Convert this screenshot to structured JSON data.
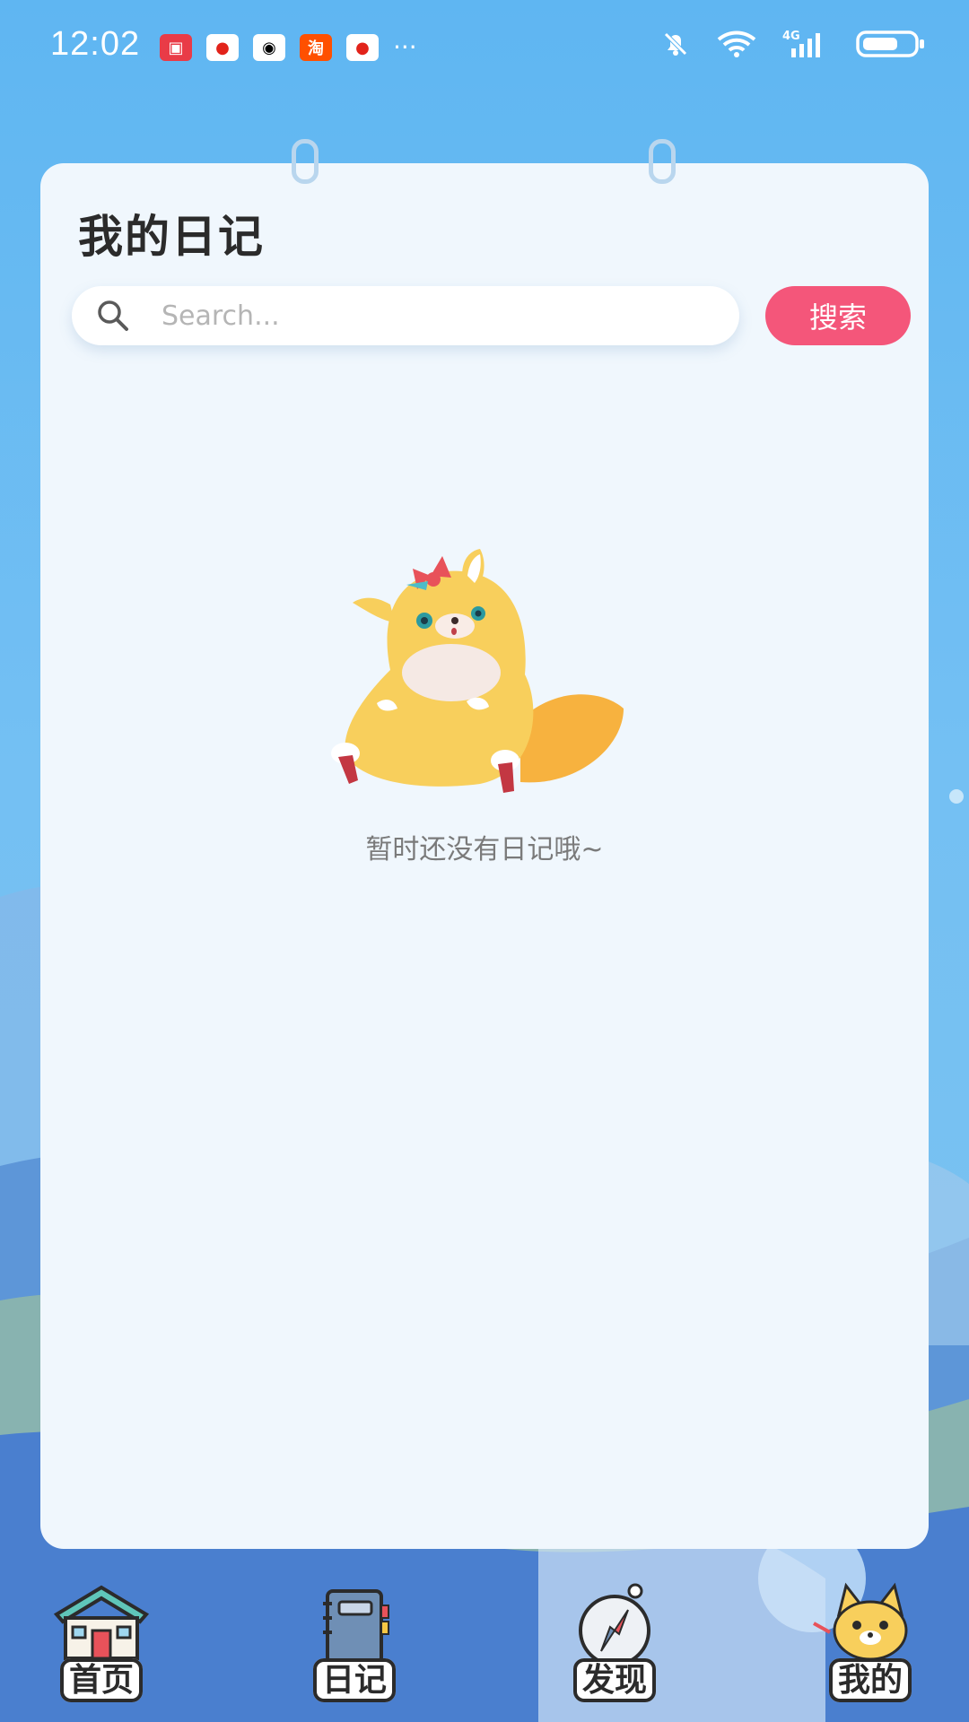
{
  "status_bar": {
    "time": "12:02",
    "notifications": [
      "huawei-icon",
      "jd-icon",
      "qq-icon",
      "taobao-icon",
      "jd-icon"
    ],
    "more": "···",
    "network": "4G"
  },
  "page": {
    "title": "我的日记",
    "search": {
      "placeholder": "Search...",
      "value": ""
    },
    "search_button_label": "搜索",
    "empty_message": "暂时还没有日记哦~"
  },
  "bottom_nav": {
    "items": [
      {
        "label": "首页",
        "icon": "home-icon"
      },
      {
        "label": "日记",
        "icon": "notebook-icon"
      },
      {
        "label": "发现",
        "icon": "compass-icon"
      },
      {
        "label": "我的",
        "icon": "fox-avatar-icon"
      }
    ]
  },
  "colors": {
    "background": "#5fb6f2",
    "card": "#f0f7fd",
    "accent": "#f4567a",
    "title_text": "#2b2b2b",
    "muted_text": "#7a7a7a"
  }
}
